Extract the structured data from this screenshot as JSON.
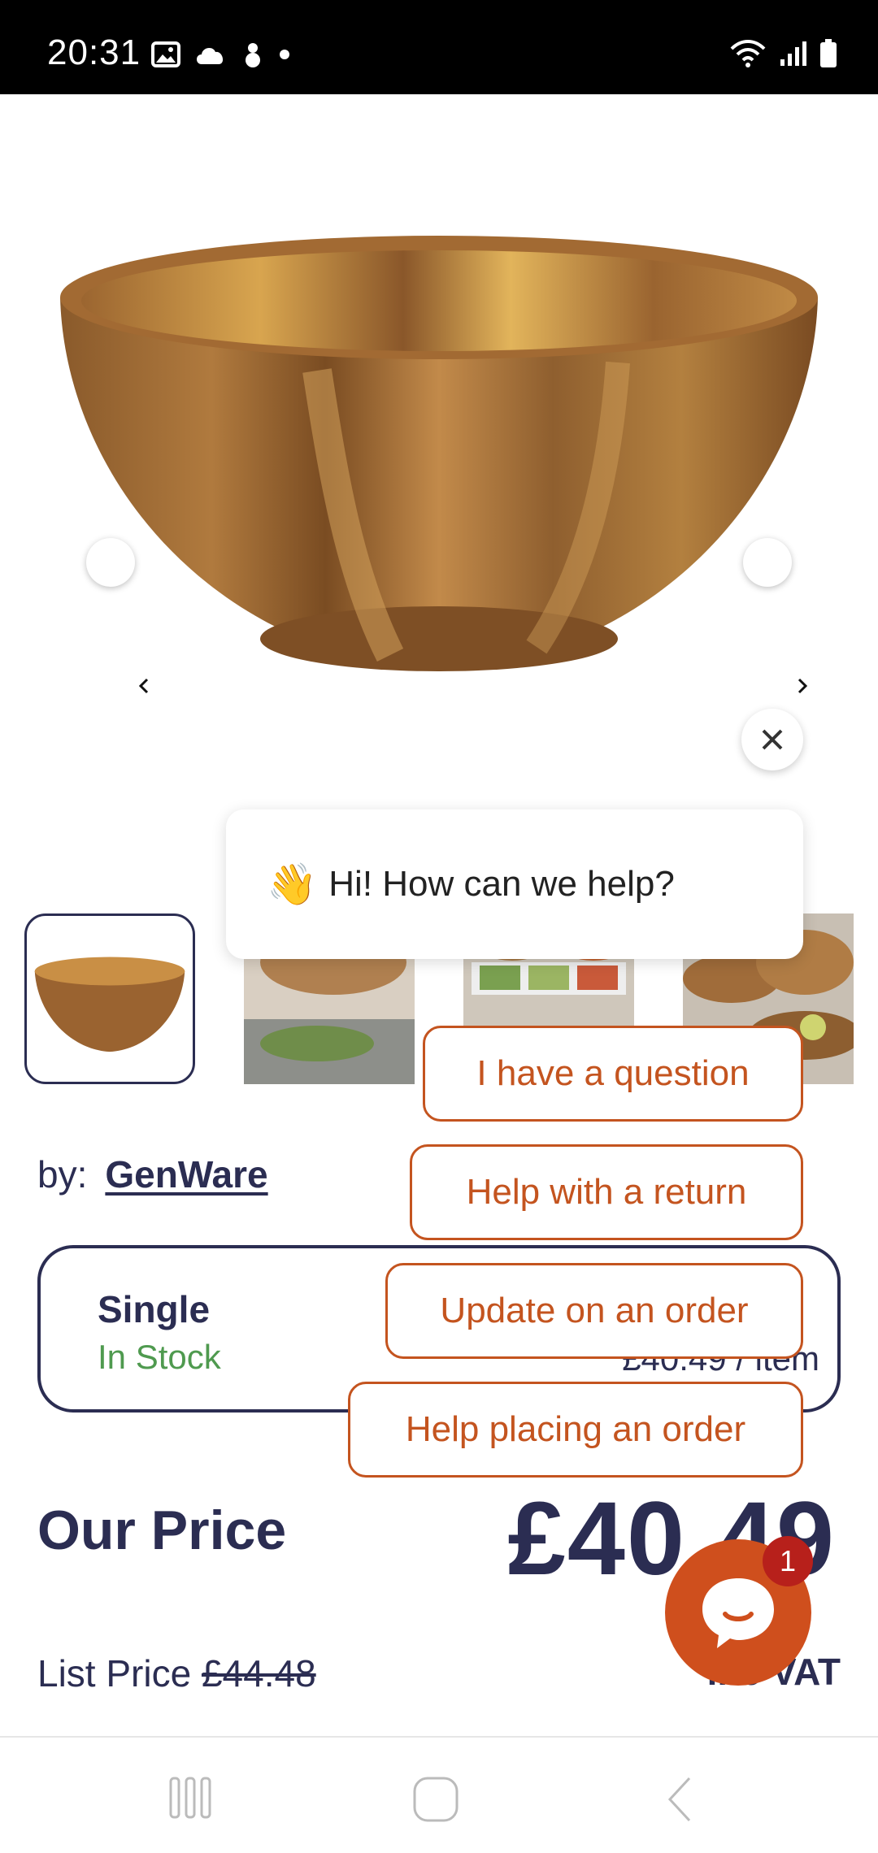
{
  "status_bar": {
    "time": "20:31",
    "left_icons": [
      "gallery-icon",
      "cloud-icon",
      "snowman-icon",
      "dot-icon"
    ],
    "right_icons": [
      "wifi-icon",
      "signal-icon",
      "battery-icon"
    ]
  },
  "gallery": {
    "prev_icon": "chevron-left-icon",
    "next_icon": "chevron-right-icon",
    "thumbnails": [
      "wooden-bowl",
      "bowls-with-bread",
      "salad-dishes",
      "table-spread"
    ]
  },
  "chat": {
    "greeting": "Hi! How can we help?",
    "greeting_emoji": "👋",
    "quick_replies": [
      "I have a question",
      "Help with a return",
      "Update on an order",
      "Help placing an order"
    ],
    "unread_count": "1",
    "accent_color": "#c4541f"
  },
  "product": {
    "by_label": "by:",
    "brand": "GenWare",
    "variant_name": "Single",
    "stock_status": "In Stock",
    "unit_price": "£40.49 / item",
    "our_price_label": "Our Price",
    "our_price": "£40.49",
    "list_price_label": "List Price",
    "list_price": "£44.48",
    "vat_label": "inc VAT"
  },
  "colors": {
    "navy": "#2b2d52",
    "in_stock_green": "#4f9a4f",
    "chat_orange": "#cf4f1d"
  }
}
